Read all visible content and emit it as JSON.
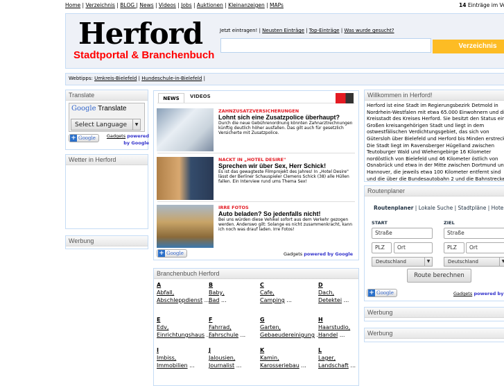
{
  "topnav": [
    "Home",
    "Verzeichnis",
    "BLOG ",
    "News",
    "Videos",
    "Jobs",
    "Auktionen",
    "Kleinanzeigen",
    "MAPs"
  ],
  "count": {
    "num": "14",
    "text": " Einträge im Verzeichnis"
  },
  "header": {
    "logo_title": "Herford",
    "logo_subtitle": "Stadtportal & Branchenbuch",
    "intro": "Jetzt eintragen! |",
    "links": [
      "Neusten Einträge",
      "Top-Einträge",
      "Was wurde gesucht?"
    ],
    "search_value": "",
    "button": "Verzeichnis"
  },
  "webtipps": {
    "label": "Webtipps:",
    "links": [
      "Umkreis-Bielefeld",
      "Hundeschule-in-Bielefeld"
    ]
  },
  "translate": {
    "title": "Translate",
    "brand": "Google",
    "brand_suffix": " Translate",
    "select": "Select Language",
    "gadgets": "Gadgets",
    "powered": "powered by Google",
    "plus": "Google"
  },
  "wetter": {
    "title": "Wetter in Herford"
  },
  "werbung": "Werbung",
  "news": {
    "tabs": [
      "NEWS",
      "VIDEOS"
    ],
    "logo": "Bild.de",
    "items": [
      {
        "kicker": "ZAHNZUSATZVERSICHERUNGEN",
        "title": "Lohnt sich eine Zusatzpolice überhaupt?",
        "desc": "Durch die neue Gebührenordnung könnten Zahnarztrechnungen künftig deutlich höher ausfallen. Das gilt auch für gesetzlich Versicherte mit Zusatzpolice."
      },
      {
        "kicker": "NACKT IN „HOTEL DESIRE\"",
        "title": "Sprechen wir über Sex, Herr Schick!",
        "desc": "Es ist das gewagteste Filmprojekt des Jahres! In „Hotel Desire\" lässt der Berliner Schauspieler Clemens Schick (38) alle Hüllen fallen. Ein Interview rund ums Thema Sex!"
      },
      {
        "kicker": "IRRE FOTOS",
        "title": "Auto beladen? So jedenfalls nicht!",
        "desc": "Bei uns würden diese Vehikel sofort aus dem Verkehr gezogen werden. Anderswo gilt: Solange es nicht zusammenkracht, kann ich noch was drauf laden. Irre Fotos!"
      }
    ],
    "gadgets": "Gadgets ",
    "powered": "powered by Google",
    "plus": "Google"
  },
  "branchenbuch": {
    "title": "Branchenbuch Herford",
    "cats": [
      {
        "letter": "A",
        "items": [
          "Abfall,",
          "Abschleppdienst"
        ]
      },
      {
        "letter": "B",
        "items": [
          "Baby,",
          "Bad"
        ]
      },
      {
        "letter": "C",
        "items": [
          "Cafe,",
          "Camping"
        ]
      },
      {
        "letter": "D",
        "items": [
          "Dach,",
          "Detektei"
        ]
      },
      {
        "letter": "E",
        "items": [
          "Edv,",
          "Einrichtungshaus"
        ]
      },
      {
        "letter": "F",
        "items": [
          "Fahrrad,",
          "Fahrschule"
        ]
      },
      {
        "letter": "G",
        "items": [
          "Garten,",
          "Gebaeudereinigung"
        ]
      },
      {
        "letter": "H",
        "items": [
          "Haarstudio,",
          "Handel"
        ]
      },
      {
        "letter": "I",
        "items": [
          "Imbiss,",
          "Immobilien"
        ]
      },
      {
        "letter": "J",
        "items": [
          "Jalousien,",
          "Journalist"
        ]
      },
      {
        "letter": "K",
        "items": [
          "Kamin,",
          "Karosseriebau"
        ]
      },
      {
        "letter": "L",
        "items": [
          "Lager,",
          "Landschaft"
        ]
      }
    ],
    "more": " ..."
  },
  "welcome": {
    "title": "Willkommen in Herford!",
    "text": "Herford ist eine Stadt im Regierungsbezirk Detmold in Nordrhein-Westfalen mit etwa 65.000 Einwohnern und die Kreisstadt des Kreises Herford. Sie besitzt den Status einer Großen kreisangehörigen Stadt und liegt in dem ostwestfälischen Verdichtungsgebiet, das sich von Gütersloh über Bielefeld und Herford bis Minden erstreckt. Die Stadt liegt im Ravensberger Hügelland zwischen Teutoburger Wald und Wiehengebirge 16 Kilometer nordöstlich von Bielefeld und 46 Kilometer östlich von Osnabrück und etwa in der Mitte zwischen Dortmund und Hannover, die jeweils etwa 100 Kilometer entfernt sind und die über die Bundesautobahn 2 und die Bahnstrecke Hamm-Minden erreichbar sind."
  },
  "route": {
    "title": "Routenplaner",
    "tabs": [
      "Routenplaner",
      "Lokale Suche",
      "Stadtpläne",
      "Hotels"
    ],
    "start": "START",
    "ziel": "ZIEL",
    "street": "Straße",
    "plz": "PLZ",
    "ort": "Ort",
    "country": "Deutschland",
    "button": "Route berechnen",
    "gadgets": "Gadgets",
    "powered": " powered by Google",
    "plus": "Google"
  },
  "colors": {
    "accent": "#fdbc24",
    "logo_red": "#ff0000",
    "kicker_red": "#e31b23",
    "border": "#c5dcf5"
  }
}
